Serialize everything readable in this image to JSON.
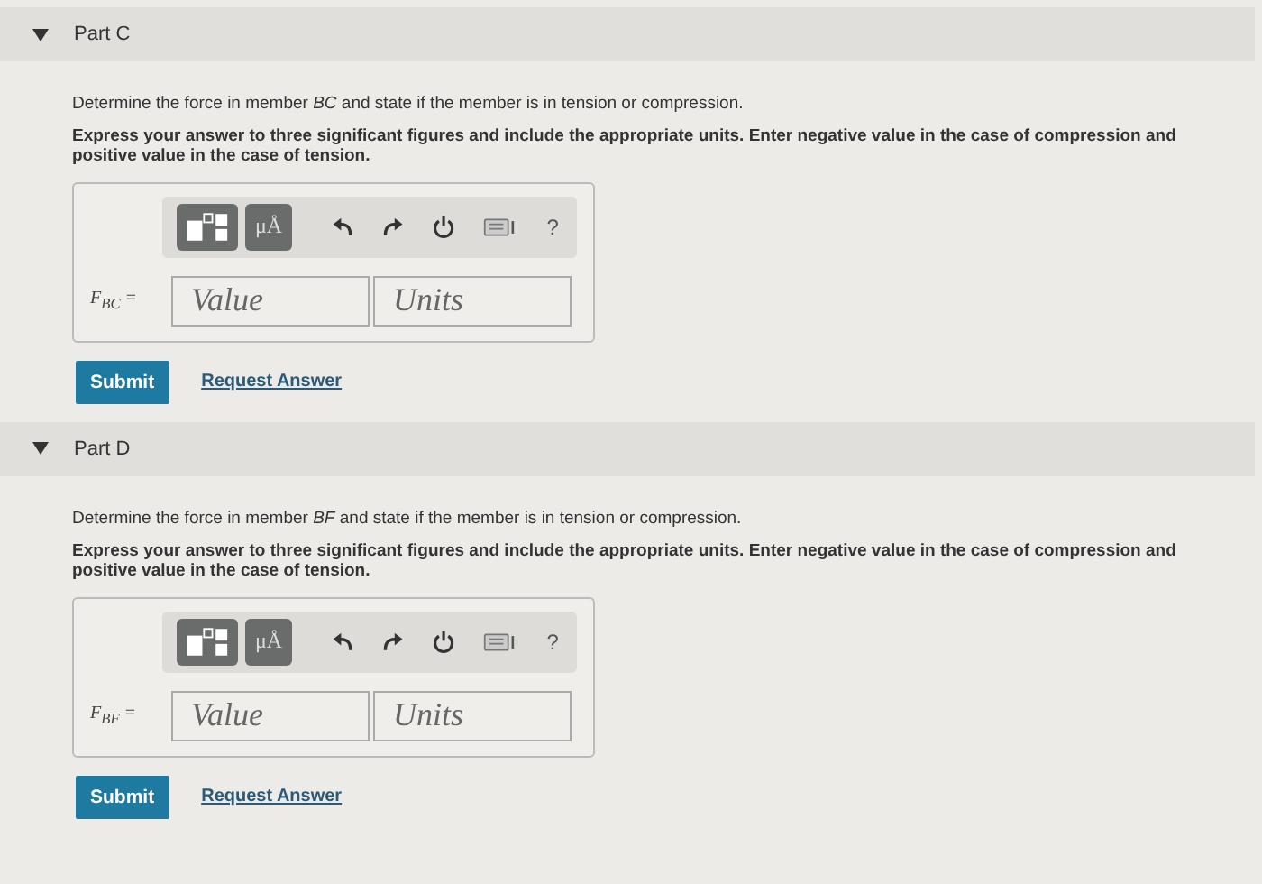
{
  "parts": [
    {
      "title": "Part C",
      "expanded": true,
      "question": "Determine the force in member *BC* and state if the member is in tension or compression.",
      "instruction": "Express your answer to three significant figures and include the appropriate units. Enter negative value in the case of compression and positive value in the case of tension.",
      "toolbar": {
        "units_button": "μÅ",
        "help": "?"
      },
      "label": "F$_{BC}$ =",
      "value_placeholder": "Value",
      "units_placeholder": "Units",
      "submit": "Submit",
      "request": "Request Answer"
    },
    {
      "title": "Part D",
      "expanded": true,
      "question": "Determine the force in member *BF* and state if the member is in tension or compression.",
      "instruction": "Express your answer to three significant figures and include the appropriate units. Enter negative value in the case of compression and positive value in the case of tension.",
      "toolbar": {
        "units_button": "μÅ",
        "help": "?"
      },
      "label": "F$_{BF}$ =",
      "value_placeholder": "Value",
      "units_placeholder": "Units",
      "submit": "Submit",
      "request": "Request Answer"
    }
  ]
}
